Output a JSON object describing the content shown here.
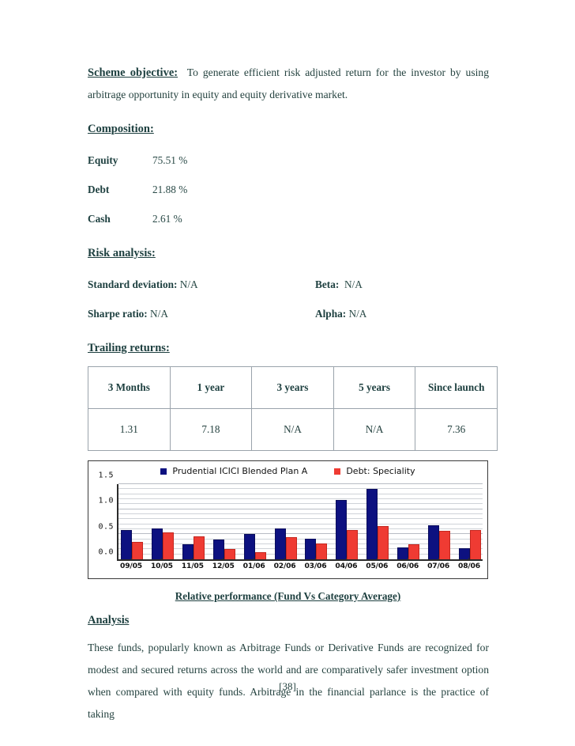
{
  "document": {
    "page_number": "[38]"
  },
  "objective": {
    "heading": "Scheme objective:",
    "body": "To generate efficient risk adjusted return for the investor by using arbitrage opportunity in equity and equity derivative market."
  },
  "composition": {
    "heading": "Composition:",
    "rows": [
      {
        "label": "Equity",
        "value": "75.51 %"
      },
      {
        "label": "Debt",
        "value": "21.88 %"
      },
      {
        "label": "Cash",
        "value": "2.61 %"
      }
    ]
  },
  "risk_analysis": {
    "heading": "Risk analysis:",
    "rows": [
      {
        "left_key": "Standard deviation:",
        "left_value": "N/A",
        "right_key": "Beta:",
        "right_value": "N/A"
      },
      {
        "left_key": "Sharpe ratio:",
        "left_value": "N/A",
        "right_key": "Alpha:",
        "right_value": "N/A"
      }
    ]
  },
  "trailing_returns": {
    "heading": "Trailing returns:",
    "columns": [
      "3 Months",
      "1 year",
      "3 years",
      "5 years",
      "Since launch"
    ],
    "values": [
      "1.31",
      "7.18",
      "N/A",
      "N/A",
      "7.36"
    ]
  },
  "chart_caption": "Relative performance (Fund Vs Category Average)",
  "analysis": {
    "heading": "Analysis",
    "body": "These funds, popularly known as Arbitrage Funds or Derivative Funds are recognized for modest and secured returns across the world and are comparatively safer investment option when compared with equity funds. Arbitrage in the financial parlance is the practice of taking"
  },
  "chart_data": {
    "type": "bar",
    "title": "",
    "xlabel": "",
    "ylabel": "",
    "ylim": [
      0.0,
      1.5
    ],
    "yticks": [
      "0.0",
      "0.5",
      "1.0",
      "1.5"
    ],
    "grid": true,
    "legend_position": "top",
    "categories": [
      "09/05",
      "10/05",
      "11/05",
      "12/05",
      "01/06",
      "02/06",
      "03/06",
      "04/06",
      "05/06",
      "06/06",
      "07/06",
      "08/06"
    ],
    "series": [
      {
        "name": "Prudential ICICI Blended Plan A",
        "color": "#0d1180",
        "values": [
          0.59,
          0.61,
          0.3,
          0.39,
          0.5,
          0.61,
          0.41,
          1.19,
          1.41,
          0.23,
          0.68,
          0.22
        ]
      },
      {
        "name": "Debt: Speciality",
        "color": "#ef3b33",
        "values": [
          0.34,
          0.54,
          0.46,
          0.21,
          0.15,
          0.44,
          0.31,
          0.59,
          0.66,
          0.3,
          0.57,
          0.58
        ]
      }
    ]
  }
}
